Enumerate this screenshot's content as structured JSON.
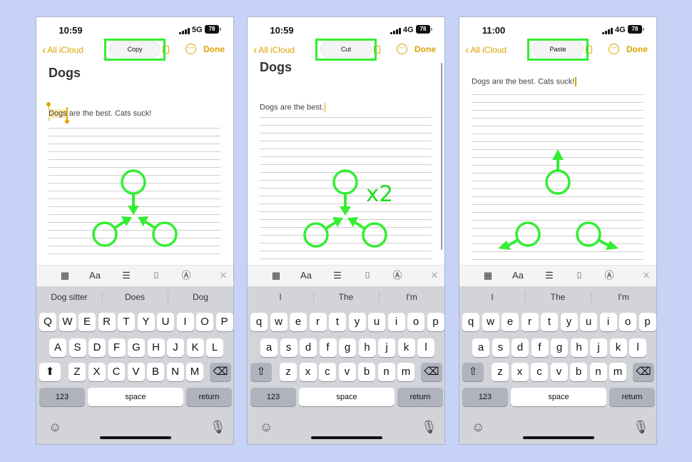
{
  "colors": {
    "background": "#c6d3f6",
    "accent": "#d9a400",
    "annotation": "#33ee33",
    "key_face": "#ffffff",
    "key_dark": "#aeb3bd",
    "keyboard_bg": "#d2d4d9"
  },
  "panels": [
    {
      "status": {
        "time": "10:59",
        "network": "5G",
        "battery": "78"
      },
      "nav": {
        "back": "All iCloud",
        "menu_item": "Copy",
        "done": "Done"
      },
      "note": {
        "title": "Dogs",
        "selected": "Dogs",
        "rest": " are the best. Cats suck!"
      },
      "suggestions": [
        "Dog sitter",
        "Does",
        "Dog"
      ],
      "keyboard": {
        "row1": [
          "Q",
          "W",
          "E",
          "R",
          "T",
          "Y",
          "U",
          "I",
          "O",
          "P"
        ],
        "row2": [
          "A",
          "S",
          "D",
          "F",
          "G",
          "H",
          "J",
          "K",
          "L"
        ],
        "row3": [
          "Z",
          "X",
          "C",
          "V",
          "B",
          "N",
          "M"
        ],
        "numbers": "123",
        "space": "space",
        "return": "return"
      },
      "gesture": {
        "fingers": 3,
        "direction": "pinch-in",
        "annotation": ""
      }
    },
    {
      "status": {
        "time": "10:59",
        "network": "4G",
        "battery": "78"
      },
      "nav": {
        "back": "All iCloud",
        "menu_item": "Cut",
        "done": "Done"
      },
      "note": {
        "title": "Dogs",
        "selected": "",
        "rest": "Dogs are the best."
      },
      "suggestions": [
        "I",
        "The",
        "I'm"
      ],
      "keyboard": {
        "row1": [
          "q",
          "w",
          "e",
          "r",
          "t",
          "y",
          "u",
          "i",
          "o",
          "p"
        ],
        "row2": [
          "a",
          "s",
          "d",
          "f",
          "g",
          "h",
          "j",
          "k",
          "l"
        ],
        "row3": [
          "z",
          "x",
          "c",
          "v",
          "b",
          "n",
          "m"
        ],
        "numbers": "123",
        "space": "space",
        "return": "return"
      },
      "gesture": {
        "fingers": 3,
        "direction": "pinch-in",
        "annotation": "x2"
      }
    },
    {
      "status": {
        "time": "11:00",
        "network": "4G",
        "battery": "78"
      },
      "nav": {
        "back": "All iCloud",
        "menu_item": "Paste",
        "done": "Done"
      },
      "note": {
        "title": "",
        "selected": "",
        "rest": "Dogs are the best. Cats suck!"
      },
      "suggestions": [
        "I",
        "The",
        "I'm"
      ],
      "keyboard": {
        "row1": [
          "q",
          "w",
          "e",
          "r",
          "t",
          "y",
          "u",
          "i",
          "o",
          "p"
        ],
        "row2": [
          "a",
          "s",
          "d",
          "f",
          "g",
          "h",
          "j",
          "k",
          "l"
        ],
        "row3": [
          "z",
          "x",
          "c",
          "v",
          "b",
          "n",
          "m"
        ],
        "numbers": "123",
        "space": "space",
        "return": "return"
      },
      "gesture": {
        "fingers": 3,
        "direction": "spread-out",
        "annotation": ""
      }
    }
  ]
}
